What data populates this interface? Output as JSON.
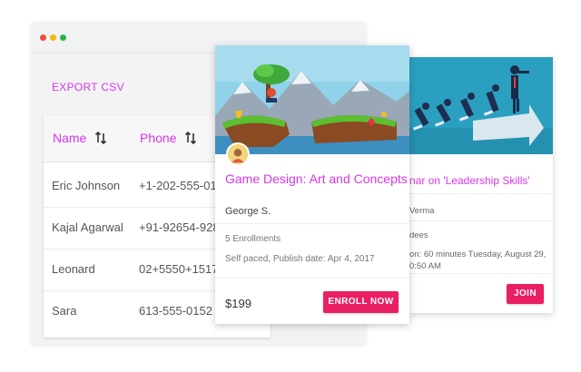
{
  "table": {
    "export_label": "EXPORT CSV",
    "headers": [
      "Name",
      "Phone"
    ],
    "rows": [
      [
        "Eric Johnson",
        "+1-202-555-014"
      ],
      [
        "Kajal Agarwal",
        "+91-92654-928"
      ],
      [
        "Leonard",
        "02+5550+1517"
      ],
      [
        "Sara",
        "613-555-0152"
      ]
    ]
  },
  "course_card": {
    "title": "Game Design: Art and Concepts",
    "author": "George S.",
    "enrollments": "5 Enrollments",
    "schedule": "Self paced, Publish date: Apr 4, 2017",
    "price": "$199",
    "button": "ENROLL NOW"
  },
  "webinar_card": {
    "title": "nar on 'Leadership Skills'",
    "host": "Verma",
    "attendees": "dees",
    "duration_line1": "on: 60 minutes Tuesday, August 29,",
    "duration_line2": "0:50 AM",
    "button": "JOIN"
  },
  "colors": {
    "accent": "#d636e8",
    "button": "#ea1f63"
  }
}
